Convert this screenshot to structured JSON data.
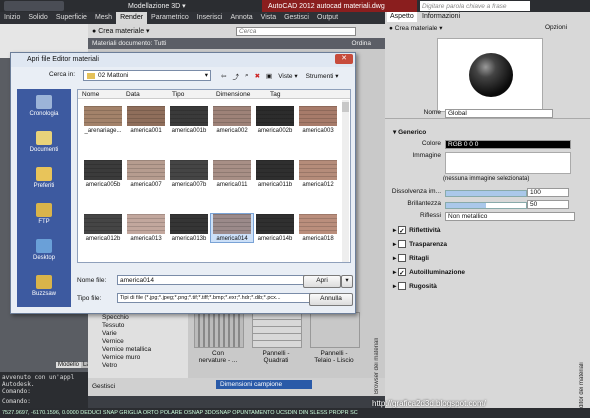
{
  "titlebar": {
    "workspace": "Modellazione 3D",
    "app_title": "AutoCAD 2012  autocad materiali.dwg",
    "search_placeholder": "Digitare parola chiave a frase"
  },
  "ribbon_tabs": [
    "Inizio",
    "Solido",
    "Superficie",
    "Mesh",
    "Render",
    "Parametrico",
    "Inserisci",
    "Annota",
    "Vista",
    "Gestisci",
    "Output"
  ],
  "browser": {
    "create_label": "Crea materiale",
    "search_placeholder": "Cerca",
    "doc_materials": "Materiali documento: Tutti",
    "order": "Ordina",
    "vertical_title": "Browser dei materiali",
    "categories": [
      "Specchio",
      "Tessuto",
      "Varie",
      "Vernice",
      "Vernice metallica",
      "Vernice muro",
      "Vetro"
    ],
    "tiles": [
      {
        "caption": "Con\nnervature - ..."
      },
      {
        "caption": "Pannelli -\nQuadrati"
      },
      {
        "caption": "Pannelli -\nTelaio - Liscio"
      }
    ],
    "dimension_label": "Dimensioni campione",
    "footer_label": "Gestisci"
  },
  "right": {
    "tabs": [
      "Aspetto",
      "Informazioni"
    ],
    "create_label": "Crea materiale",
    "options_label": "Opzioni",
    "name_label": "Nome",
    "name_value": "Global",
    "generic_section": "Generico",
    "color_label": "Colore",
    "color_value": "RGB 0 0 0",
    "image_label": "Immagine",
    "no_image": "(nessuna immagine selezionata)",
    "dissolve_label": "Dissolvenza im...",
    "dissolve_value": "100",
    "gloss_label": "Brillantezza",
    "gloss_value": "50",
    "reflections_label": "Riflessi",
    "reflections_value": "Non metallico",
    "sections": [
      {
        "label": "Riflettività",
        "checked": true
      },
      {
        "label": "Trasparenza",
        "checked": false
      },
      {
        "label": "Ritagli",
        "checked": false
      },
      {
        "label": "Autoilluminazione",
        "checked": true
      },
      {
        "label": "Rugosità",
        "checked": false
      }
    ],
    "vertical_title": "Editor dei materiali"
  },
  "command": {
    "lines": [
      "avvenuto con un'appl",
      "Autodesk.",
      "Comando:"
    ],
    "prompt": "Comando:"
  },
  "status_bar": "7527.9697, -6170.1596, 0.0000   DEDUCI  SNAP  GRIGLIA  ORTO  POLARE  OSNAP  3DOSNAP  OPUNTAMENTO  UCSDIN  DIN  SLESS  PROPR  SC",
  "watermark": "http://grafica2d3d.blogspot.com/",
  "model_tabs": [
    "Modello",
    "Layou"
  ],
  "dialog": {
    "title": "Apri file Editor materiali",
    "look_in_label": "Cerca in:",
    "folder": "02 Mattoni",
    "toolbar": {
      "view": "Viste",
      "tools": "Strumenti"
    },
    "columns": [
      "Nome",
      "Data",
      "Tipo",
      "Dimensione",
      "Tag"
    ],
    "places": [
      "Cronologia",
      "Documenti",
      "Preferiti",
      "FTP",
      "Desktop",
      "Buzzsaw"
    ],
    "files": [
      {
        "name": "_arenariage...",
        "color": "#a3826a"
      },
      {
        "name": "america001",
        "color": "#8f6e5b"
      },
      {
        "name": "america001b",
        "color": "#3a3a3a"
      },
      {
        "name": "america002",
        "color": "#9e8278"
      },
      {
        "name": "america002b",
        "color": "#2c2c2c"
      },
      {
        "name": "america003",
        "color": "#a77b6a"
      },
      {
        "name": "america005b",
        "color": "#3b3b3b"
      },
      {
        "name": "america007",
        "color": "#b69c8f"
      },
      {
        "name": "america007b",
        "color": "#454545"
      },
      {
        "name": "america011",
        "color": "#a88f86"
      },
      {
        "name": "america011b",
        "color": "#2f2f2f"
      },
      {
        "name": "america012",
        "color": "#b58c7a"
      },
      {
        "name": "america012b",
        "color": "#454545"
      },
      {
        "name": "america013",
        "color": "#c2a79d"
      },
      {
        "name": "america013b",
        "color": "#353535"
      },
      {
        "name": "america014",
        "color": "#9b8a8a",
        "selected": true
      },
      {
        "name": "america014b",
        "color": "#303030"
      },
      {
        "name": "america018",
        "color": "#ba8e7c"
      }
    ],
    "filename_label": "Nome file:",
    "filename_value": "america014",
    "filetype_label": "Tipo file:",
    "filetype_value": "Tipi di file (*.jpg;*.jpeg;*.png;*.tif;*.tiff;*.bmp;*.exr;*.hdr;*.dib;*.pcx...",
    "open_button": "Apri",
    "cancel_button": "Annulla"
  }
}
